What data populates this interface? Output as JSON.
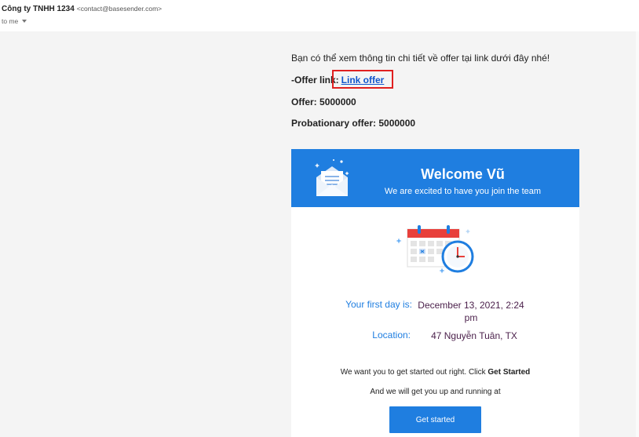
{
  "header": {
    "sender_name": "Công ty TNHH 1234",
    "sender_email": "<contact@basesender.com>",
    "recipient": "to me"
  },
  "body": {
    "intro": "Bạn có thể xem thông tin chi tiết về offer tại link dưới đây nhé!",
    "offer_link_label": "-Offer link:",
    "offer_link_text": "Link offer",
    "offer_label": "Offer:",
    "offer_value": "5000000",
    "probationary_label": "Probationary offer:",
    "probationary_value": "5000000"
  },
  "card": {
    "welcome_title": "Welcome Vũ",
    "welcome_subtitle": "We are excited to have you join the team",
    "first_day_label": "Your first day is:",
    "first_day_value_line1": "December 13, 2021, 2:24",
    "first_day_value_line2": "pm",
    "location_label": "Location:",
    "location_value": "47 Nguyễn Tuân, TX",
    "para1_text": "We want you to get started out right. Click ",
    "para1_bold": "Get Started",
    "para2_text": "And we will get you up and running at",
    "cta_label": "Get started"
  },
  "colors": {
    "accent_blue": "#1f7ee0",
    "link_blue": "#1155cc",
    "highlight_red": "#e02020",
    "value_purple": "#4a1f4a",
    "body_bg": "#f4f4f4"
  },
  "icons": {
    "envelope": "envelope-icon",
    "calendar": "calendar-clock-icon",
    "caret": "chevron-down-icon"
  }
}
